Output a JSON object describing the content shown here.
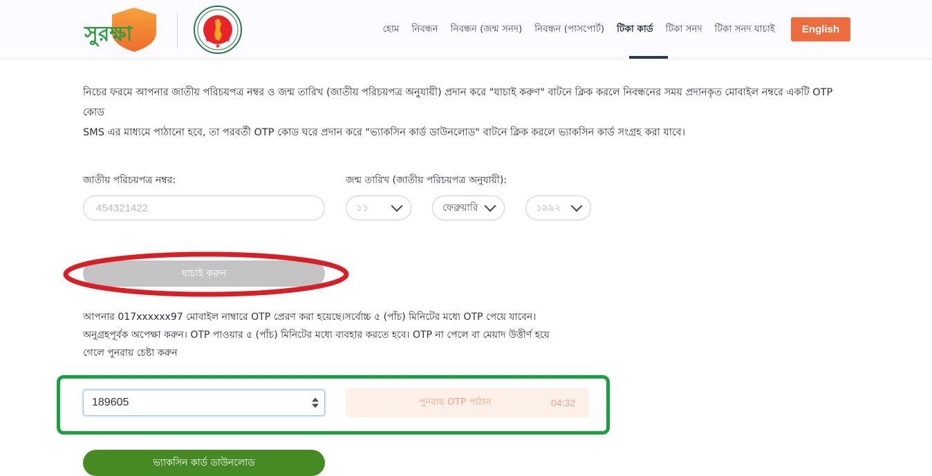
{
  "header": {
    "logo_text": "সুরক্ষা",
    "govt_emblem_top_text": "গণপ্রজাতন্ত্রী বাংলাদেশ",
    "govt_emblem_bottom_text": "সরকার",
    "nav": [
      {
        "label": "হোম",
        "active": false
      },
      {
        "label": "নিবন্ধন",
        "active": false
      },
      {
        "label": "নিবন্ধন (জন্ম সনদ)",
        "active": false
      },
      {
        "label": "নিবন্ধন (পাসপোর্ট)",
        "active": false
      },
      {
        "label": "টিকা কার্ড",
        "active": true
      },
      {
        "label": "টিকা সনদ",
        "active": false
      },
      {
        "label": "টিকা সনদ যাচাই",
        "active": false
      }
    ],
    "language_button": "English"
  },
  "main": {
    "intro_line1": "নিচের ফরমে আপনার জাতীয় পরিচয়পত্র নম্বর ও জন্ম তারিখ (জাতীয় পরিচয়পত্র অনুযায়ী) প্রদান করে \"যাচাই করুণ\" বাটনে ক্লিক করলে নিবন্ধনের সময় প্রদানকৃত মোবাইল নম্বরে একটি OTP কোড",
    "intro_line2": "SMS এর মাধ্যমে পাঠানো হবে, তা পরবর্তী OTP কোড ঘরে প্রদান করে \"ভ্যাকসিন কার্ড ডাউনলোড\" বাটনে ক্লিক করলে ভ্যাকসিন কার্ড সংগ্রহ করা যাবে।",
    "nid": {
      "label": "জাতীয় পরিচয়পত্র নম্বর:",
      "value": "454321422"
    },
    "dob": {
      "label": "জন্ম তারিখ (জাতীয় পরিচয়পত্র অনুযায়ী):",
      "day": "১১",
      "month": "ফেব্রুয়ারি",
      "year": "১৯৯২"
    },
    "verify_button": "যাচাই করুন",
    "otp_note_line1": "আপনার 017xxxxxx97 মোবাইল নাম্বারে OTP প্রেরণ করা হয়েছে।সর্বোচ্চ ৫ (পাঁচ) মিনিটের মধ্যে OTP পেয়ে যাবেন।",
    "otp_note_line2": "অনুগ্রহপূর্বক অপেক্ষা করুন। OTP পাওয়ার ৫ (পাঁচ) মিনিটের মধ্যে ব্যবহার করতে হবে। OTP না পেলে বা মেয়াদ উত্তীর্ণ হয়ে",
    "otp_note_line3": "গেলে পুনরায় চেষ্টা করুন",
    "otp_input_value": "189605",
    "resend_label": "পুনরায় OTP পাঠান",
    "resend_timer": "04:32",
    "download_button": "ভ্যাকসিন কার্ড ডাউনলোড"
  },
  "annotations": {
    "red_oval_color": "#d81f26",
    "green_rect_color": "#19a03f"
  }
}
